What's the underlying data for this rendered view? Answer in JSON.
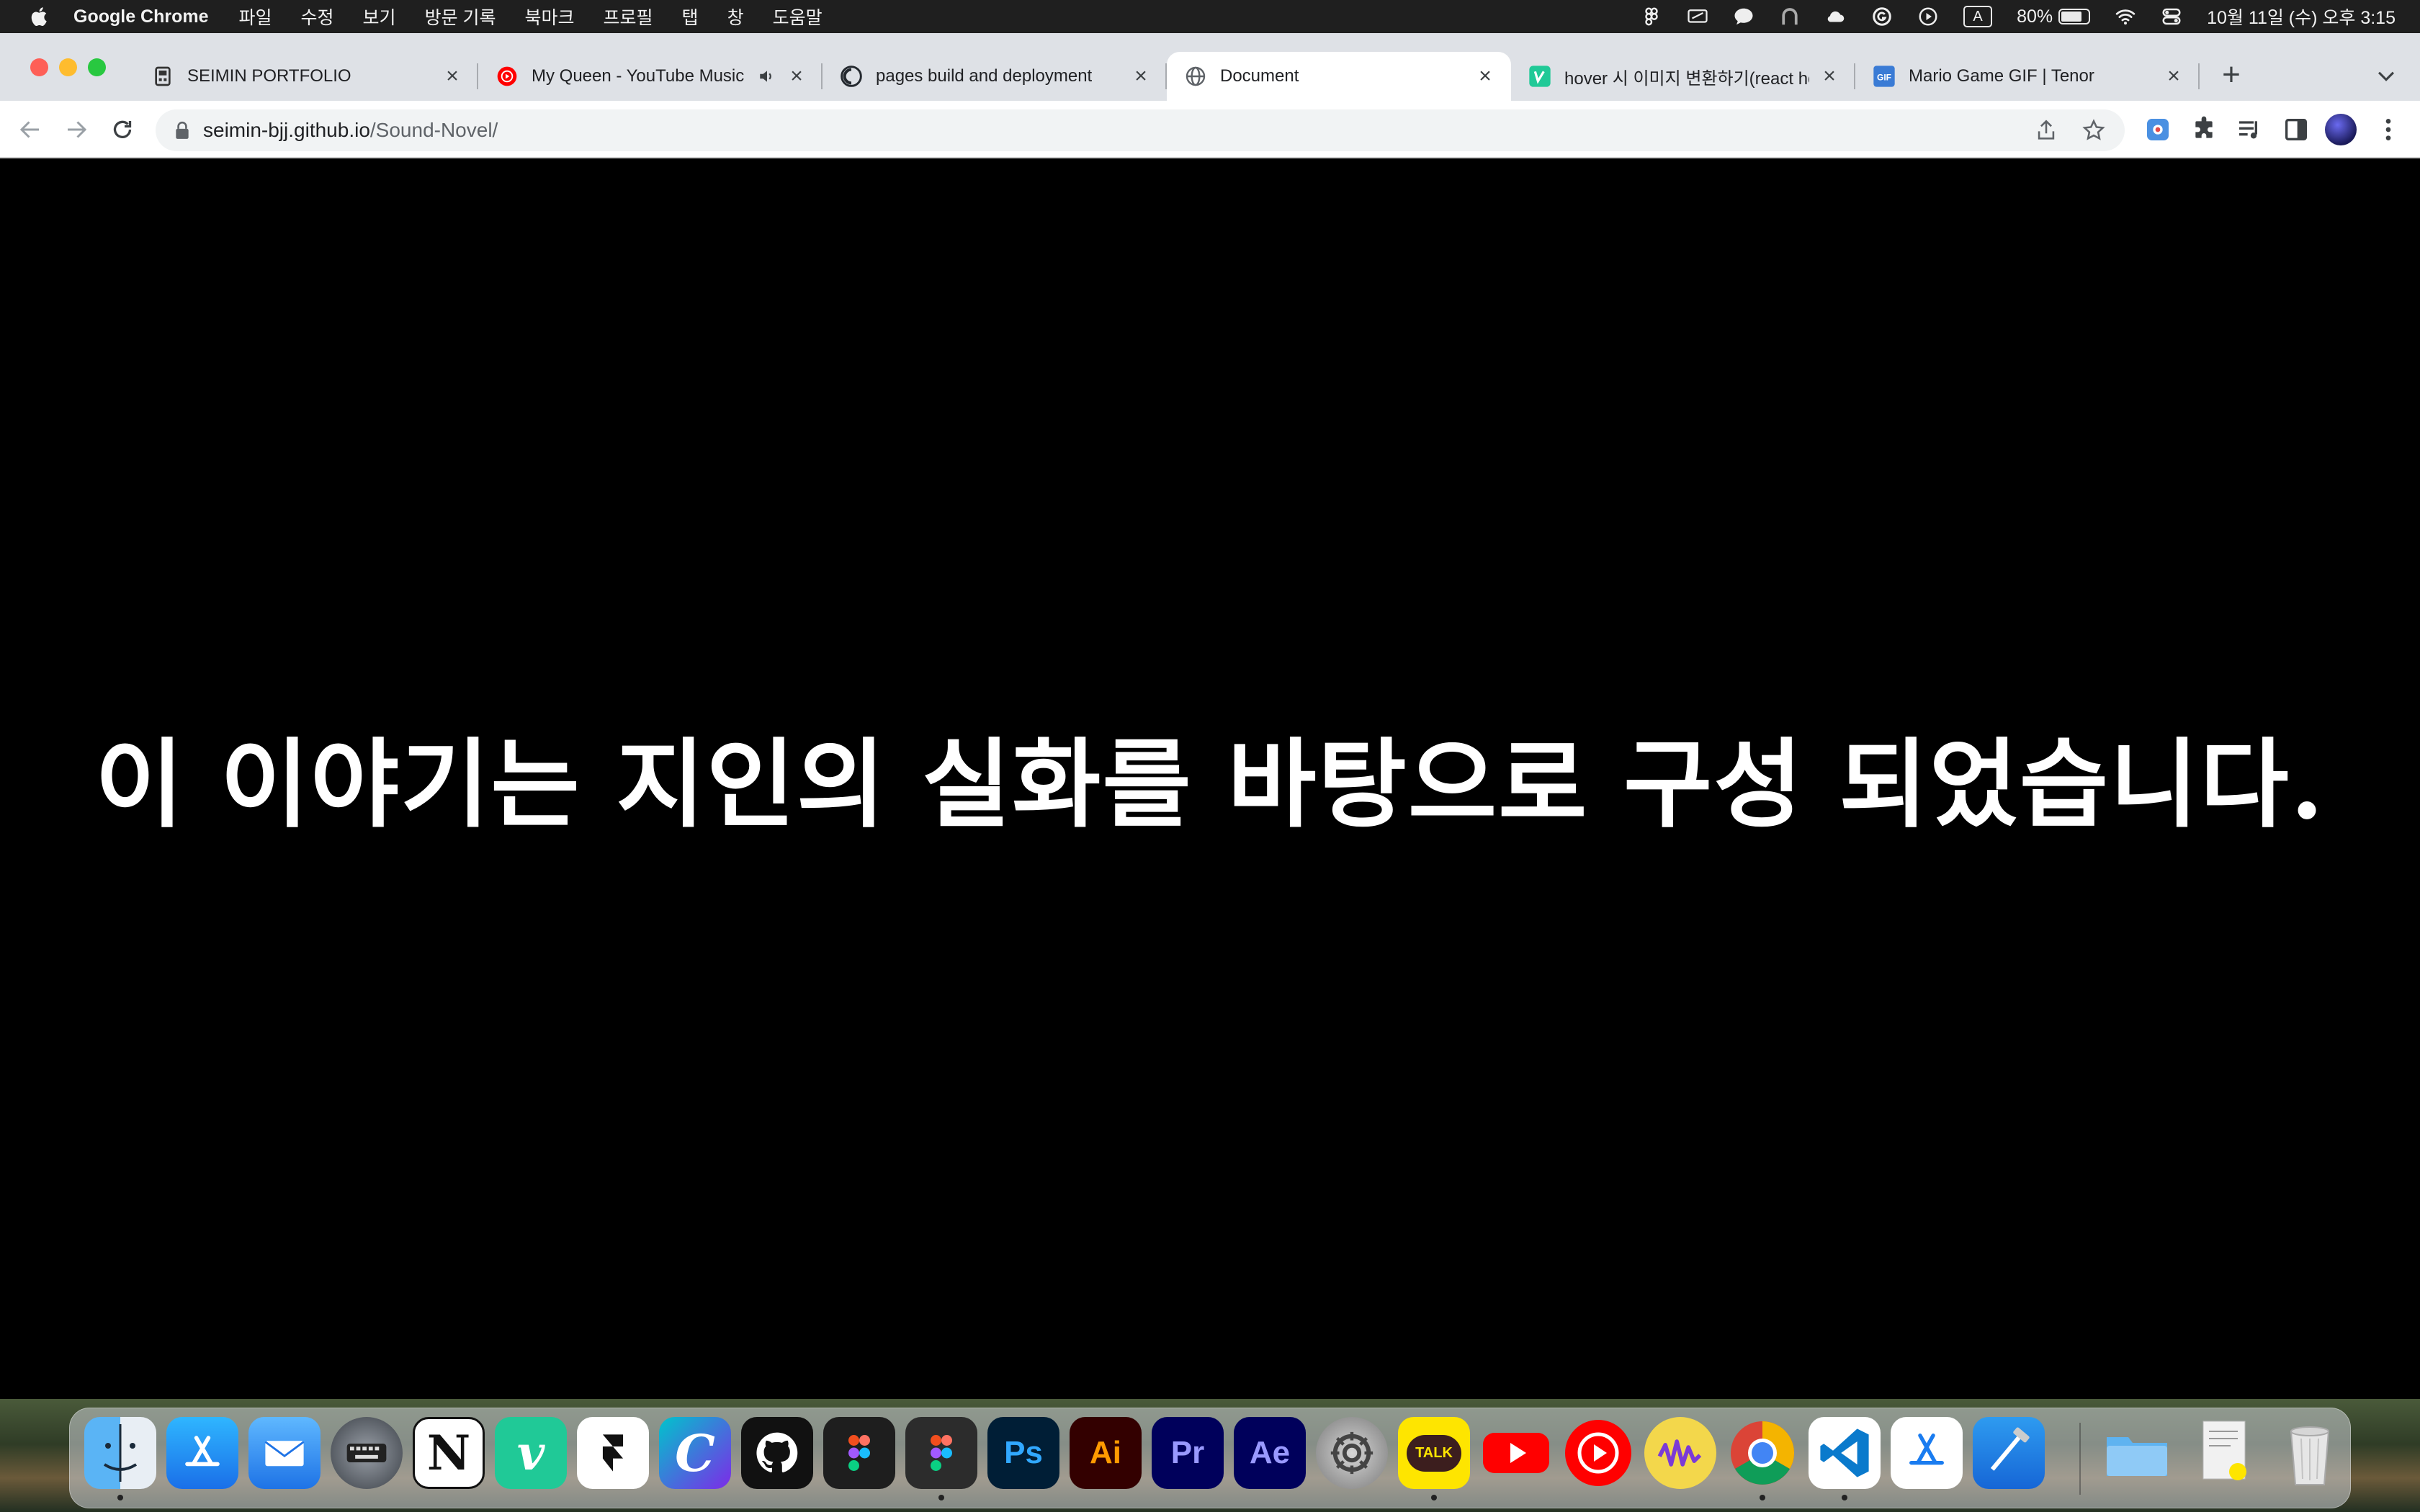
{
  "menubar": {
    "app_name": "Google Chrome",
    "menu_items": [
      "파일",
      "수정",
      "보기",
      "방문 기록",
      "북마크",
      "프로필",
      "탭",
      "창",
      "도움말"
    ],
    "input_source": "A",
    "battery_percent": "80%",
    "battery_level": 0.8,
    "datetime": "10월 11일 (수) 오후 3:15"
  },
  "tabs": [
    {
      "title": "SEIMIN PORTFOLIO",
      "icon": "page-icon",
      "active": false
    },
    {
      "title": "My Queen - YouTube Music",
      "icon": "youtube-music-icon",
      "active": false,
      "playing_audio": true
    },
    {
      "title": "pages build and deployment",
      "icon": "github-icon",
      "active": false
    },
    {
      "title": "Document",
      "icon": "globe-icon",
      "active": true
    },
    {
      "title": "hover 시 이미지 변환하기(react hook)",
      "icon": "velog-icon",
      "active": false
    },
    {
      "title": "Mario Game GIF | Tenor",
      "icon": "tenor-gif-icon",
      "active": false
    }
  ],
  "address_bar": {
    "host": "seimin-bjj.github.io",
    "path": "/Sound-Novel/"
  },
  "page": {
    "text": "이 이야기는 지인의 실화를 바탕으로 구성 되었습니다."
  },
  "dock": {
    "apps": [
      {
        "name": "Finder",
        "icon": "finder-icon",
        "running": true
      },
      {
        "name": "App Store",
        "icon": "app-store-icon",
        "running": false
      },
      {
        "name": "Mail",
        "icon": "mail-icon",
        "running": false
      },
      {
        "name": "Keyboard Viewer",
        "icon": "keyboard-icon",
        "running": false
      },
      {
        "name": "Notion",
        "icon": "notion-icon",
        "running": false
      },
      {
        "name": "Vim",
        "icon": "vim-icon",
        "running": false
      },
      {
        "name": "Framer",
        "icon": "framer-icon",
        "running": false
      },
      {
        "name": "Canva",
        "icon": "canva-icon",
        "running": false
      },
      {
        "name": "GitHub Desktop",
        "icon": "github-icon",
        "running": false
      },
      {
        "name": "Figma",
        "icon": "figma-icon",
        "running": false
      },
      {
        "name": "Figma Beta",
        "icon": "figma-beta-icon",
        "running": true
      },
      {
        "name": "Photoshop",
        "icon": "photoshop-icon",
        "label": "Ps",
        "running": false
      },
      {
        "name": "Illustrator",
        "icon": "illustrator-icon",
        "label": "Ai",
        "running": false
      },
      {
        "name": "Premiere Pro",
        "icon": "premiere-icon",
        "label": "Pr",
        "running": false
      },
      {
        "name": "After Effects",
        "icon": "after-effects-icon",
        "label": "Ae",
        "running": false
      },
      {
        "name": "System Settings",
        "icon": "settings-icon",
        "running": false
      },
      {
        "name": "KakaoTalk",
        "icon": "kakaotalk-icon",
        "label": "TALK",
        "running": true
      },
      {
        "name": "YouTube",
        "icon": "youtube-icon",
        "running": false
      },
      {
        "name": "YouTube Music",
        "icon": "youtube-music-icon",
        "running": false
      },
      {
        "name": "Sound App",
        "icon": "waveform-icon",
        "running": false
      },
      {
        "name": "Google Chrome",
        "icon": "chrome-icon",
        "running": true
      },
      {
        "name": "Visual Studio Code",
        "icon": "vscode-icon",
        "running": true
      },
      {
        "name": "Simulator",
        "icon": "simulator-icon",
        "running": false
      },
      {
        "name": "Xcode",
        "icon": "xcode-icon",
        "running": false
      },
      {
        "name": "Downloads",
        "icon": "folder-icon",
        "running": false
      },
      {
        "name": "Documents",
        "icon": "documents-stack-icon",
        "running": false
      },
      {
        "name": "Trash",
        "icon": "trash-icon",
        "running": false
      }
    ]
  },
  "colors": {
    "tabstrip_bg": "#dee1e6",
    "page_bg": "#000000",
    "page_text": "#ffffff",
    "close_red": "#fe5f57",
    "minimize_yellow": "#febc2e",
    "zoom_green": "#28c840"
  }
}
